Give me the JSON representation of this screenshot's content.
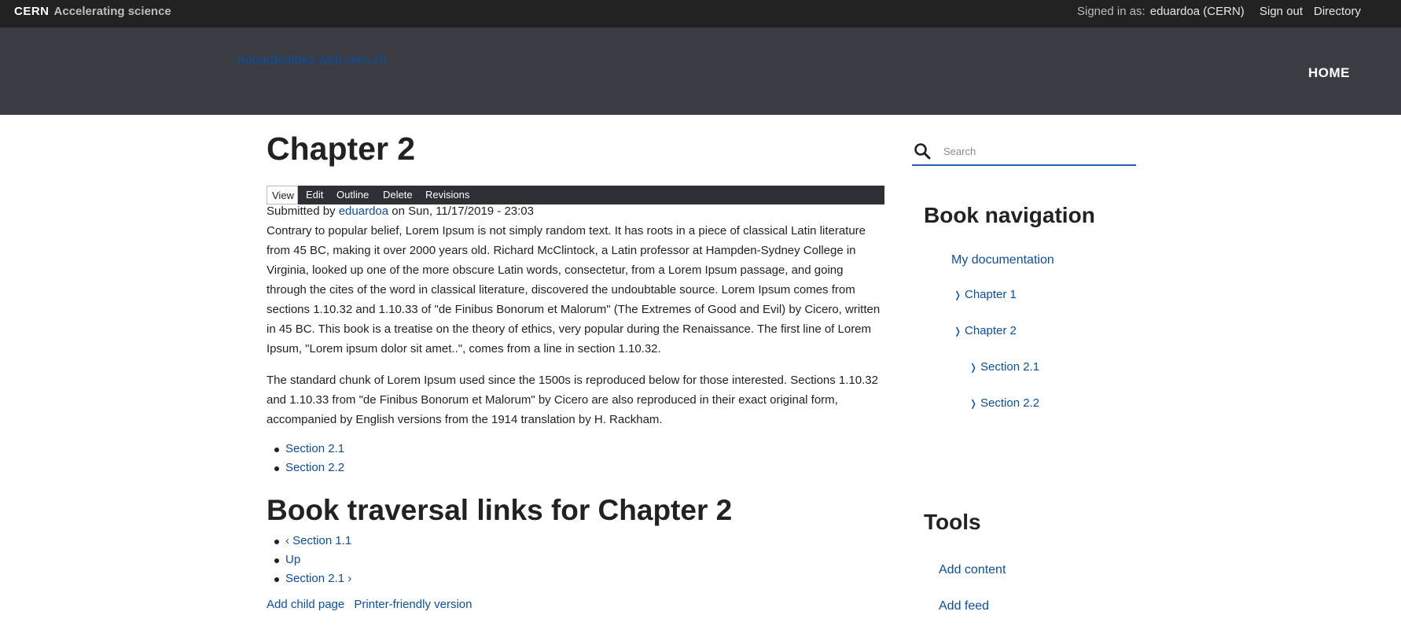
{
  "topbar": {
    "brand": "CERN",
    "tagline": "Accelerating science",
    "signed_in_label": "Signed in as:",
    "user": "eduardoa (CERN)",
    "sign_out": "Sign out",
    "directory": "Directory"
  },
  "header": {
    "site_name": "eduardoafdez.web.cern.ch",
    "home": "HOME"
  },
  "main": {
    "title": "Chapter 2",
    "tabs": [
      "View",
      "Edit",
      "Outline",
      "Delete",
      "Revisions"
    ],
    "meta": {
      "prefix": "Submitted by ",
      "author": "eduardoa",
      "suffix": " on Sun, 11/17/2019 - 23:03"
    },
    "paragraphs": [
      "Contrary to popular belief, Lorem Ipsum is not simply random text. It has roots in a piece of classical Latin literature from 45 BC, making it over 2000 years old. Richard McClintock, a Latin professor at Hampden-Sydney College in Virginia, looked up one of the more obscure Latin words, consectetur, from a Lorem Ipsum passage, and going through the cites of the word in classical literature, discovered the undoubtable source. Lorem Ipsum comes from sections 1.10.32 and 1.10.33 of \"de Finibus Bonorum et Malorum\" (The Extremes of Good and Evil) by Cicero, written in 45 BC. This book is a treatise on the theory of ethics, very popular during the Renaissance. The first line of Lorem Ipsum, \"Lorem ipsum dolor sit amet..\", comes from a line in section 1.10.32.",
      "The standard chunk of Lorem Ipsum used since the 1500s is reproduced below for those interested. Sections 1.10.32 and 1.10.33 from \"de Finibus Bonorum et Malorum\" by Cicero are also reproduced in their exact original form, accompanied by English versions from the 1914 translation by H. Rackham."
    ],
    "child_links": [
      "Section 2.1",
      "Section 2.2"
    ],
    "traversal_heading": "Book traversal links for Chapter 2",
    "traversal_links": [
      "‹ Section 1.1",
      "Up",
      "Section 2.1 ›"
    ],
    "footer_links": [
      "Add child page",
      "Printer-friendly version"
    ]
  },
  "sidebar": {
    "search_placeholder": "Search",
    "book_nav_heading": "Book navigation",
    "book_root": "My documentation",
    "book_items": [
      "Chapter 1",
      "Chapter 2",
      "Section 2.1",
      "Section 2.2"
    ],
    "tools_heading": "Tools",
    "tools": [
      "Add content",
      "Add feed"
    ]
  },
  "icons": {
    "search": "search-icon",
    "chevron": "chevron-right-icon"
  },
  "colors": {
    "topbar": "#222222",
    "header": "#393c42",
    "link": "#0b4fa0",
    "search_underline": "#2b5ca8"
  }
}
